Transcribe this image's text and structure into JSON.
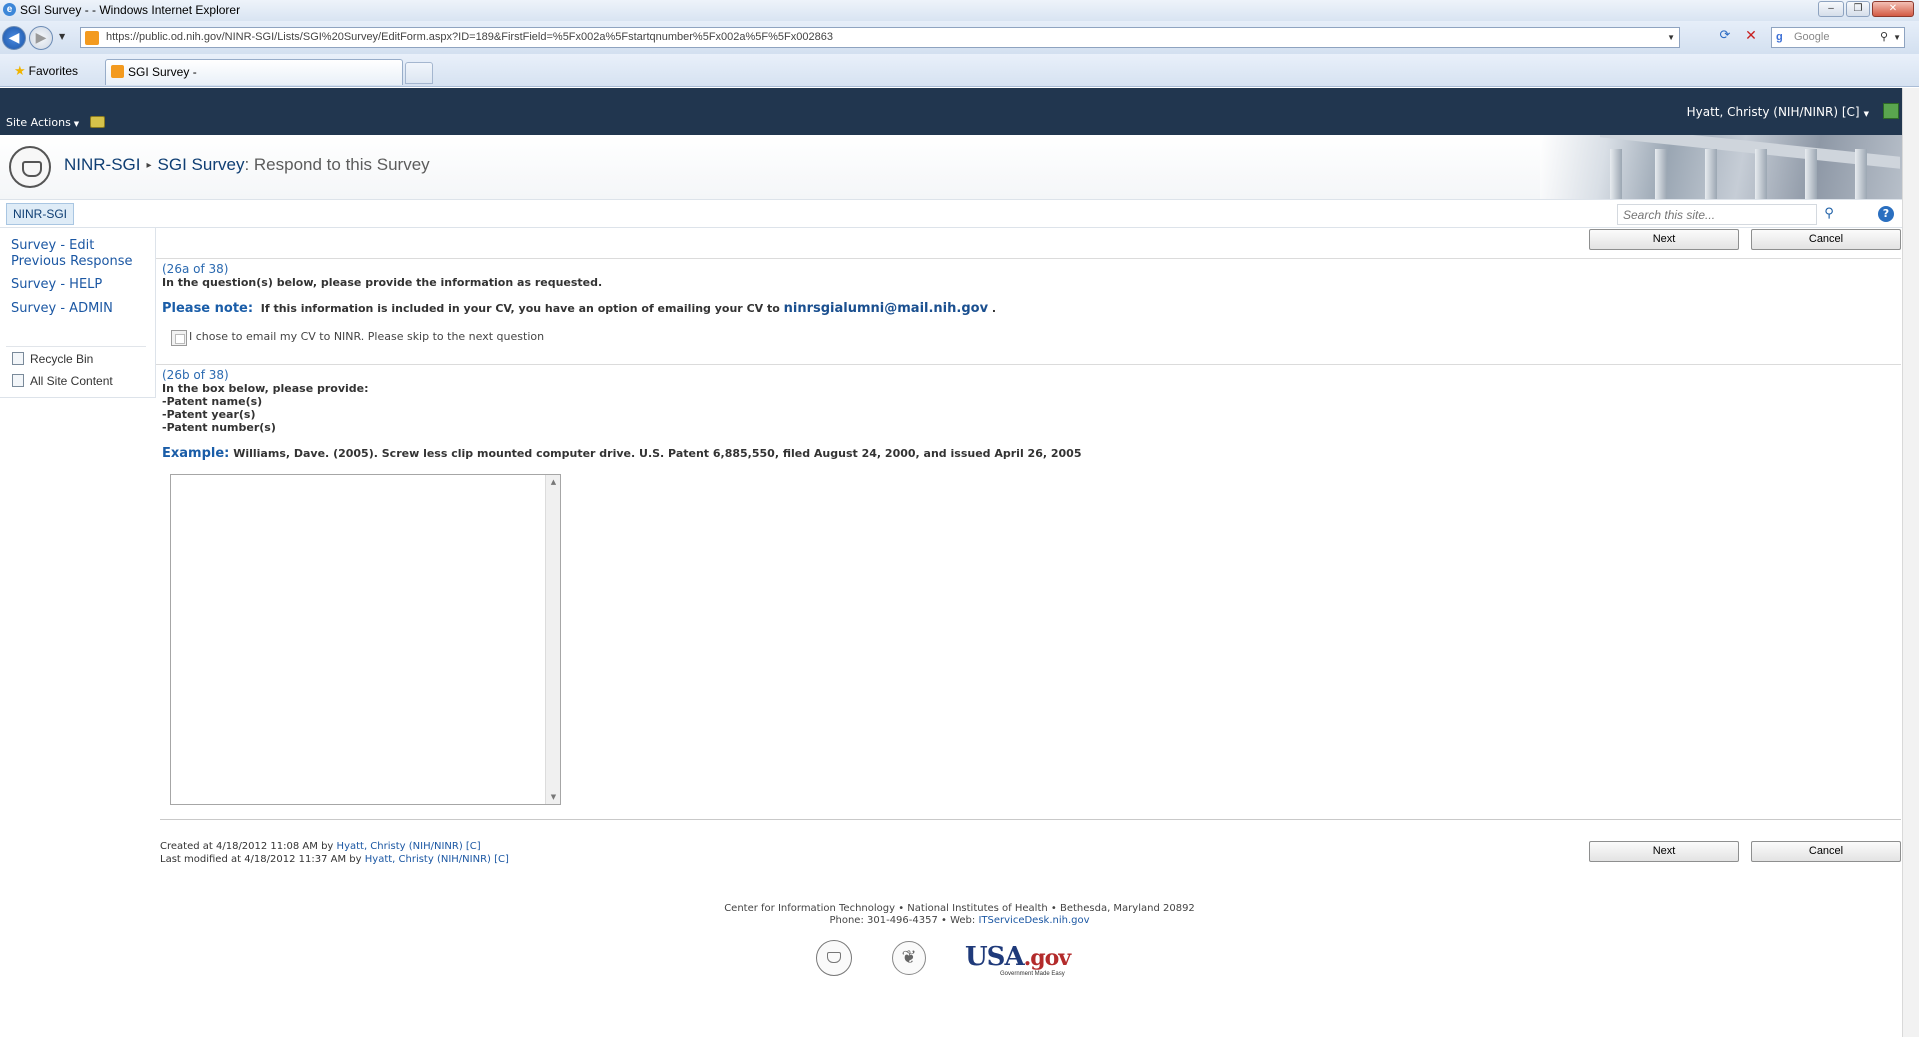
{
  "window": {
    "title": "SGI Survey - - Windows Internet Explorer",
    "minimize": "–",
    "restore": "❐",
    "close": "✕"
  },
  "browser": {
    "url": "https://public.od.nih.gov/NINR-SGI/Lists/SGI%20Survey/EditForm.aspx?ID=189&FirstField=%5Fx002a%5Fstartqnumber%5Fx002a%5F%5Fx002863",
    "search_placeholder": "Google",
    "favorites_label": "Favorites",
    "tab_title": "SGI Survey -"
  },
  "sharepoint_bar": {
    "site_actions": "Site Actions",
    "user": "Hyatt, Christy (NIH/NINR) [C]"
  },
  "header": {
    "site": "NINR-SGI",
    "list": "SGI Survey",
    "page": ": Respond to this Survey"
  },
  "topnav": {
    "home_tab": "NINR-SGI",
    "search_placeholder": "Search this site..."
  },
  "quicklaunch": {
    "links": [
      "Survey - Edit Previous Response",
      "Survey - HELP",
      "Survey - ADMIN"
    ],
    "recycle_bin": "Recycle Bin",
    "all_site_content": "All Site Content"
  },
  "form": {
    "next_label": "Next",
    "cancel_label": "Cancel",
    "q26a": {
      "number": "(26a of 38)",
      "instruction": "In the question(s) below, please provide the information as requested.",
      "note_head": "Please note:",
      "note_text": "If this information is included in your CV, you have an option of emailing your CV to",
      "email": "ninrsgialumni@mail.nih.gov",
      "note_end": ".",
      "checkbox_label": "I chose to email my CV to NINR. Please skip to the next question",
      "checked": false
    },
    "q26b": {
      "number": "(26b of 38)",
      "lines": [
        "In the box below, please provide:",
        "-Patent name(s)",
        "-Patent year(s)",
        "-Patent number(s)"
      ],
      "example_head": "Example:",
      "example_text": "Williams, Dave. (2005). Screw less clip mounted computer drive. U.S. Patent 6,885,550, filed August 24, 2000, and issued April 26, 2005",
      "value": ""
    },
    "created": {
      "prefix": "Created at 4/18/2012 11:08 AM by",
      "user": "Hyatt, Christy (NIH/NINR) [C]"
    },
    "modified": {
      "prefix": "Last modified at 4/18/2012 11:37 AM by",
      "user": "Hyatt, Christy (NIH/NINR) [C]"
    }
  },
  "footer": {
    "line1": "Center for Information Technology • National Institutes of Health • Bethesda, Maryland 20892",
    "line2_prefix": "Phone: 301-496-4357 • Web:",
    "web": "ITServiceDesk.nih.gov",
    "usa_main": "USA",
    "usa_gov": ".gov",
    "usa_tag": "Government Made Easy"
  },
  "colors": {
    "sp_bar": "#21364f",
    "link": "#1b57a3",
    "note": "#1a5da8"
  }
}
